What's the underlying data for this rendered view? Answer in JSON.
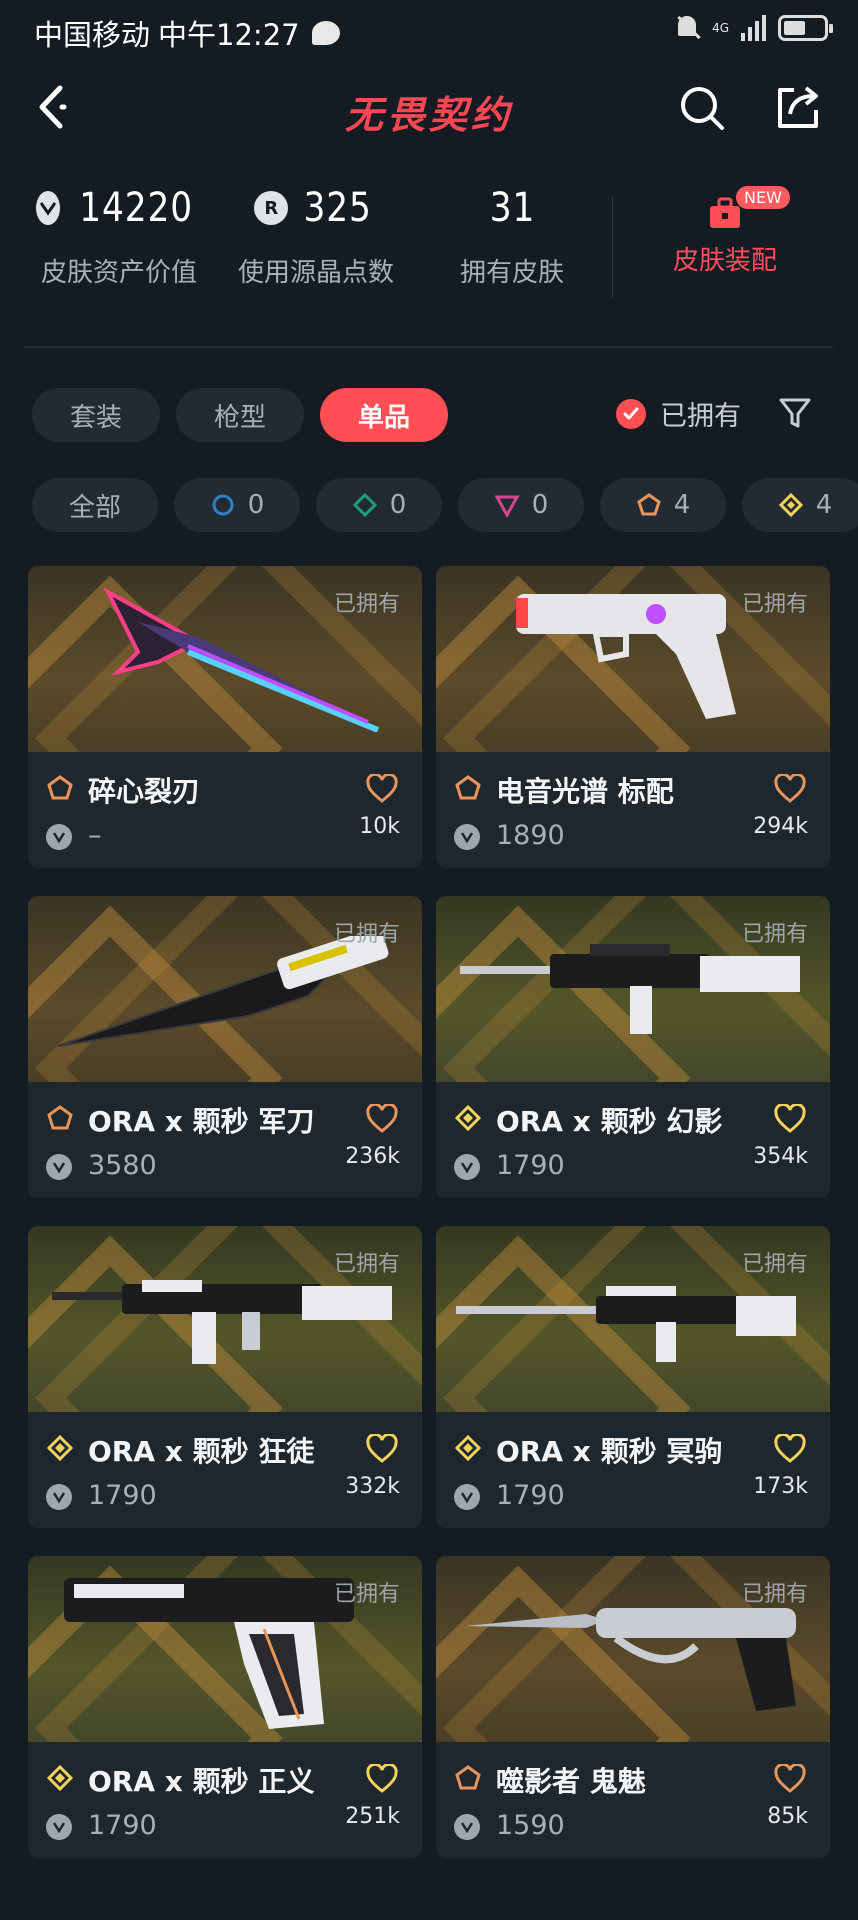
{
  "status_bar": {
    "carrier": "中国移动",
    "time": "中午12:27",
    "network": "4G"
  },
  "header": {
    "title": "无畏契约"
  },
  "stats": [
    {
      "value": "14220",
      "label": "皮肤资产价值",
      "icon": "vp-icon"
    },
    {
      "value": "325",
      "label": "使用源晶点数",
      "icon": "radianite-icon"
    },
    {
      "value": "31",
      "label": "拥有皮肤"
    }
  ],
  "equip": {
    "label": "皮肤装配",
    "badge": "NEW"
  },
  "tabs": [
    "套装",
    "枪型",
    "单品"
  ],
  "active_tab": "单品",
  "owned_filter": {
    "label": "已拥有",
    "checked": true
  },
  "chips": [
    {
      "label": "全部"
    },
    {
      "count": "0",
      "icon": "select-tier-icon",
      "color": "#2f7fc8"
    },
    {
      "count": "0",
      "icon": "deluxe-tier-icon",
      "color": "#1f9c7e"
    },
    {
      "count": "0",
      "icon": "premium-tier-icon",
      "color": "#d4478f"
    },
    {
      "count": "4",
      "icon": "exclusive-tier-icon",
      "color": "#e8955a"
    },
    {
      "count": "4",
      "icon": "ultra-tier-icon",
      "color": "#f3d35a"
    }
  ],
  "cards": [
    {
      "owned": "已拥有",
      "name": "碎心裂刃",
      "price": "–",
      "likes": "10k",
      "rarity": "exclusive"
    },
    {
      "owned": "已拥有",
      "name": "电音光谱 标配",
      "price": "1890",
      "likes": "294k",
      "rarity": "exclusive"
    },
    {
      "owned": "已拥有",
      "name": "ORA x 颗秒 军刀",
      "price": "3580",
      "likes": "236k",
      "rarity": "exclusive"
    },
    {
      "owned": "已拥有",
      "name": "ORA x 颗秒 幻影",
      "price": "1790",
      "likes": "354k",
      "rarity": "ultra"
    },
    {
      "owned": "已拥有",
      "name": "ORA x 颗秒 狂徒",
      "price": "1790",
      "likes": "332k",
      "rarity": "ultra"
    },
    {
      "owned": "已拥有",
      "name": "ORA x 颗秒 冥驹",
      "price": "1790",
      "likes": "173k",
      "rarity": "ultra"
    },
    {
      "owned": "已拥有",
      "name": "ORA x 颗秒 正义",
      "price": "1790",
      "likes": "251k",
      "rarity": "ultra"
    },
    {
      "owned": "已拥有",
      "name": "噬影者 鬼魅",
      "price": "1590",
      "likes": "85k",
      "rarity": "exclusive"
    }
  ],
  "colors": {
    "accent": "#ff4f55",
    "background": "#141b22",
    "card": "#1e262e",
    "exclusive": "#e8955a",
    "ultra": "#f3d35a"
  }
}
